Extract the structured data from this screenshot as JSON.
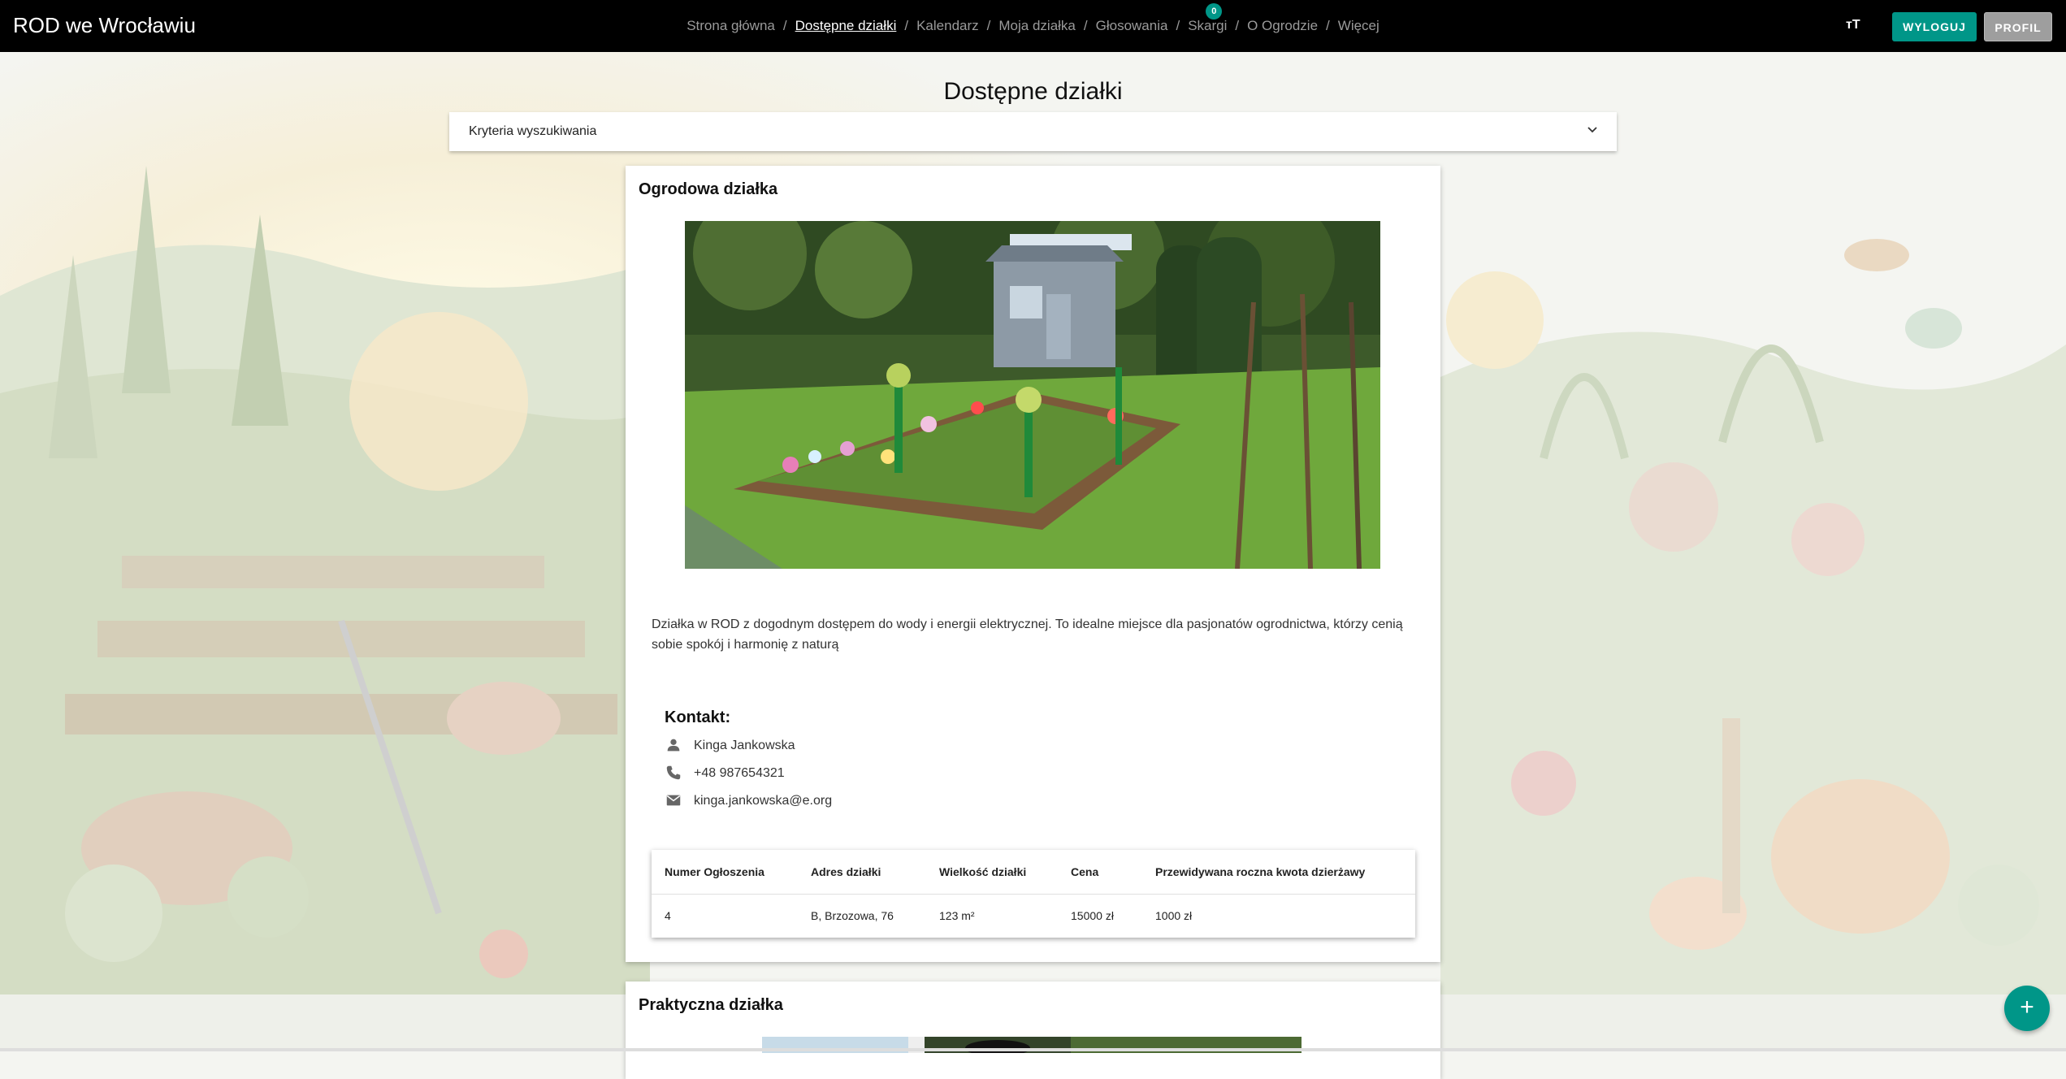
{
  "app": {
    "title": "ROD we Wrocławiu"
  },
  "nav": {
    "items": [
      {
        "label": "Strona główna"
      },
      {
        "label": "Dostępne działki"
      },
      {
        "label": "Kalendarz"
      },
      {
        "label": "Moja działka"
      },
      {
        "label": "Głosowania"
      },
      {
        "label": "Skargi"
      },
      {
        "label": "O Ogrodzie"
      },
      {
        "label": "Więcej"
      }
    ],
    "separator": "/",
    "active_index": 1,
    "complaints_badge": "0"
  },
  "toolbar": {
    "text_size_icon": "ᴛT",
    "logout_label": "WYLOGUJ",
    "profile_label": "PROFIL"
  },
  "page": {
    "title": "Dostępne działki"
  },
  "search": {
    "label": "Kryteria wyszukiwania",
    "icon": "chevron-down-icon"
  },
  "listings": [
    {
      "title": "Ogrodowa działka",
      "description": "Działka w ROD z dogodnym dostępem do wody i energii elektrycznej. To idealne miejsce dla pasjonatów ogrodnictwa, którzy cenią sobie spokój i harmonię z naturą",
      "contact": {
        "heading": "Kontakt:",
        "name": "Kinga Jankowska",
        "phone": "+48 987654321",
        "email": "kinga.jankowska@e.org"
      },
      "table": {
        "headers": [
          "Numer Ogłoszenia",
          "Adres działki",
          "Wielkość działki",
          "Cena",
          "Przewidywana roczna kwota dzierżawy"
        ],
        "row": [
          "4",
          "B, Brzozowa, 76",
          "123 m²",
          "15000 zł",
          "1000 zł"
        ]
      }
    },
    {
      "title": "Praktyczna działka"
    }
  ],
  "fab": {
    "label": "+"
  },
  "colors": {
    "accent": "#009688",
    "topbar": "#000000",
    "profile_button": "#9e9e9e"
  }
}
